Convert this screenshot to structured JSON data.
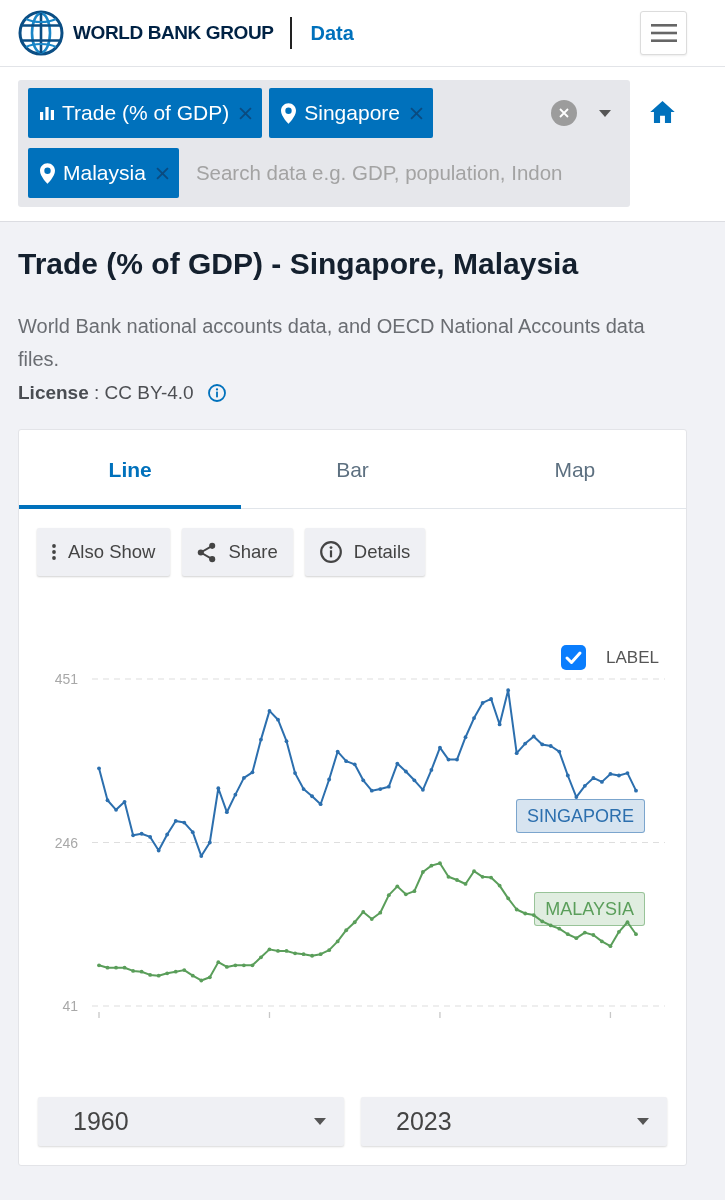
{
  "header": {
    "logo_text": "WORLD BANK GROUP",
    "section": "Data"
  },
  "filters": {
    "chips": [
      {
        "kind": "indicator",
        "label": "Trade (% of GDP)"
      },
      {
        "kind": "country",
        "label": "Singapore"
      },
      {
        "kind": "country",
        "label": "Malaysia"
      }
    ],
    "search": {
      "placeholder": "Search data e.g. GDP, population, Indon"
    }
  },
  "title": "Trade (% of GDP) - Singapore, Malaysia",
  "source": "World Bank national accounts data, and OECD National Accounts data files.",
  "license": "**License** : CC BY-4.0",
  "tabs": [
    {
      "label": "Line",
      "selected": true
    },
    {
      "label": "Bar",
      "selected": false
    },
    {
      "label": "Map",
      "selected": false
    }
  ],
  "actions": [
    {
      "kind": "more",
      "label": "Also Show"
    },
    {
      "kind": "share",
      "label": "Share"
    },
    {
      "kind": "info",
      "label": "Details"
    }
  ],
  "label_toggle": {
    "label": "LABEL",
    "checked": true
  },
  "chart": {
    "chart_data": {
      "type": "line",
      "categories": [
        null,
        null,
        null,
        null,
        null,
        null,
        null,
        null,
        null,
        null,
        null,
        null,
        null,
        null,
        null,
        null,
        null,
        null,
        null,
        null,
        null,
        null,
        null,
        null,
        null,
        null,
        null,
        null,
        null,
        null,
        null,
        null,
        null,
        null,
        null,
        null,
        null,
        null,
        null,
        null,
        null,
        null,
        null,
        null,
        null,
        null,
        null,
        null,
        null,
        null,
        null,
        null,
        null,
        null,
        null,
        null,
        null,
        null,
        null,
        null,
        null,
        null,
        null,
        null
      ],
      "ylim": [
        41,
        451
      ],
      "yticks": [
        {
          "value": 41,
          "label": "41"
        },
        {
          "value": 246,
          "label": "246"
        },
        {
          "value": 451,
          "label": "451"
        }
      ],
      "series": [
        {
          "name": "SINGAPORE",
          "color": "#2c6fae",
          "values": [
            339,
            299,
            287,
            297,
            255,
            257,
            253,
            236,
            256,
            273,
            271,
            259,
            229,
            246,
            314,
            284,
            306,
            327,
            334,
            375,
            411,
            400,
            373,
            333,
            313,
            304,
            294,
            325,
            360,
            348,
            344,
            324,
            311,
            313,
            316,
            345,
            335,
            324,
            312,
            337,
            365,
            350,
            350,
            378,
            402,
            421,
            426,
            394,
            437,
            358,
            370,
            379,
            369,
            367,
            360,
            330,
            303,
            317,
            327,
            322,
            332,
            330,
            333,
            311
          ]
        },
        {
          "name": "MALAYSIA",
          "color": "#5a9e5a",
          "values": [
            92,
            89,
            89,
            89,
            85,
            84,
            80,
            79,
            82,
            84,
            86,
            79,
            73,
            77,
            96,
            90,
            92,
            92,
            92,
            102,
            112,
            110,
            110,
            107,
            106,
            104,
            106,
            111,
            122,
            136,
            146,
            159,
            150,
            158,
            180,
            191,
            181,
            185,
            209,
            217,
            220,
            203,
            199,
            194,
            210,
            203,
            202,
            192,
            176,
            162,
            157,
            155,
            147,
            142,
            138,
            131,
            126,
            133,
            130,
            122,
            116,
            134,
            146,
            131
          ]
        }
      ]
    }
  },
  "year_range": {
    "start": "1960",
    "end": "2023"
  }
}
